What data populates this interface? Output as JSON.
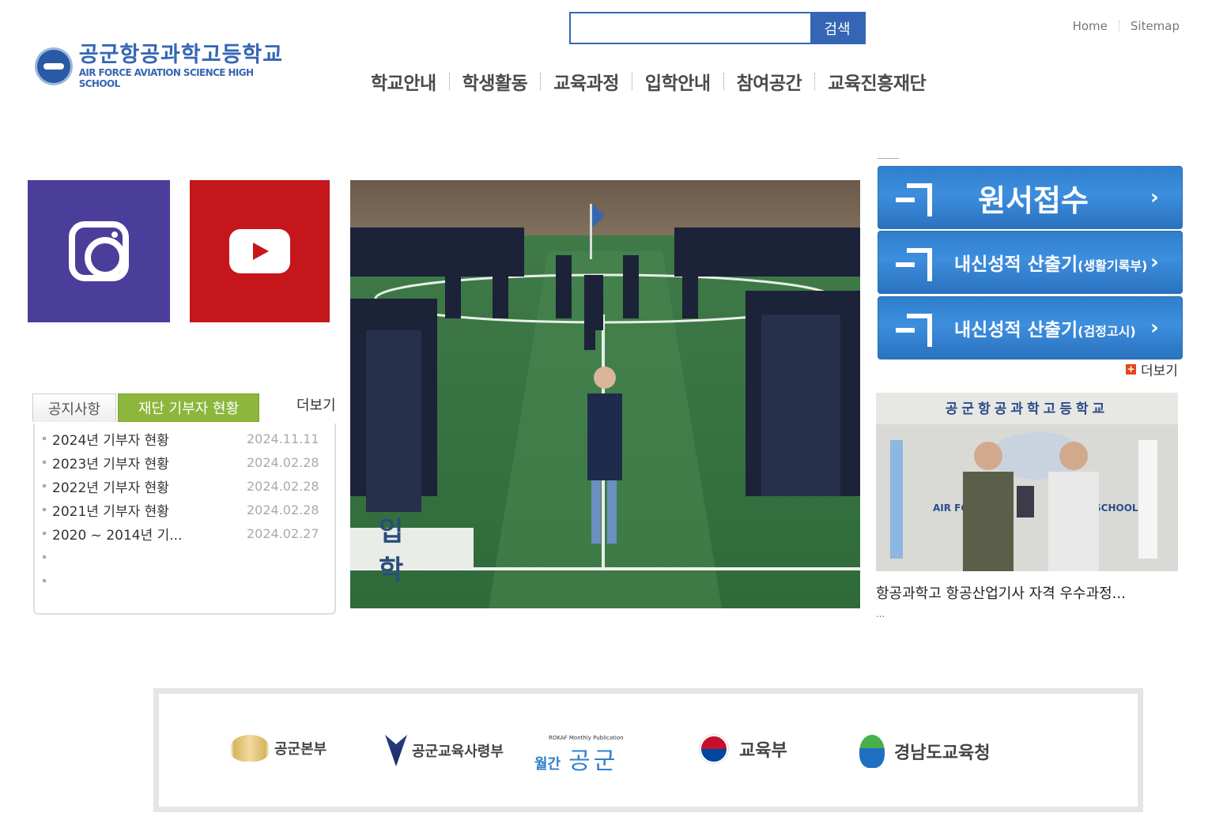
{
  "header": {
    "logo_ko": "공군항공과학고등학교",
    "logo_en": "AIR FORCE AVIATION SCIENCE HIGH SCHOOL",
    "search": {
      "placeholder": "",
      "button_label": "검색"
    },
    "util_links": [
      "Home",
      "Sitemap"
    ],
    "gnb": [
      "학교안내",
      "학생활동",
      "교육과정",
      "입학안내",
      "참여공간",
      "교육진흥재단"
    ]
  },
  "sns": {
    "instagram_icon": "instagram-icon",
    "youtube_icon": "youtube-icon"
  },
  "board": {
    "tabs": [
      "공지사항",
      "재단 기부자 현황"
    ],
    "more_label": "더보기",
    "items": [
      {
        "title": "2024년 기부자 현황",
        "date": "2024.11.11"
      },
      {
        "title": "2023년 기부자 현황",
        "date": "2024.02.28"
      },
      {
        "title": "2022년 기부자 현황",
        "date": "2024.02.28"
      },
      {
        "title": "2021년 기부자 현황",
        "date": "2024.02.28"
      },
      {
        "title": "2020 ~ 2014년 기...",
        "date": "2024.02.27"
      },
      {
        "title": "",
        "date": ""
      },
      {
        "title": "",
        "date": ""
      }
    ]
  },
  "visual": {
    "caption": "입 학"
  },
  "quick": {
    "apply_label": "원서접수",
    "grade1_label": "내신성적 산출기",
    "grade1_sub": "(생활기록부)",
    "grade2_label": "내신성적 산출기",
    "grade2_sub": "(검정고시)",
    "arrow": "›",
    "more_label": "더보기"
  },
  "news": {
    "photo_banner_text": "공군항공과학고등학교",
    "photo_wall_text": "AIR FOR",
    "photo_wall_text2": "SCHOOL",
    "title": "항공과학고 항공산업기사 자격 우수과정...",
    "sub": "..."
  },
  "banners": [
    {
      "label": "공군본부",
      "icon": "wing-emblem-icon"
    },
    {
      "label": "공군교육사령부",
      "icon": "eagle-emblem-icon"
    },
    {
      "label_top": "ROKAF Monthly Publication",
      "label_a": "월간",
      "label_b": "공군",
      "icon": "monthly-logo"
    },
    {
      "label": "교육부",
      "icon": "taegeuk-icon"
    },
    {
      "label": "경남도교육청",
      "icon": "gyeongnam-edu-icon"
    }
  ]
}
